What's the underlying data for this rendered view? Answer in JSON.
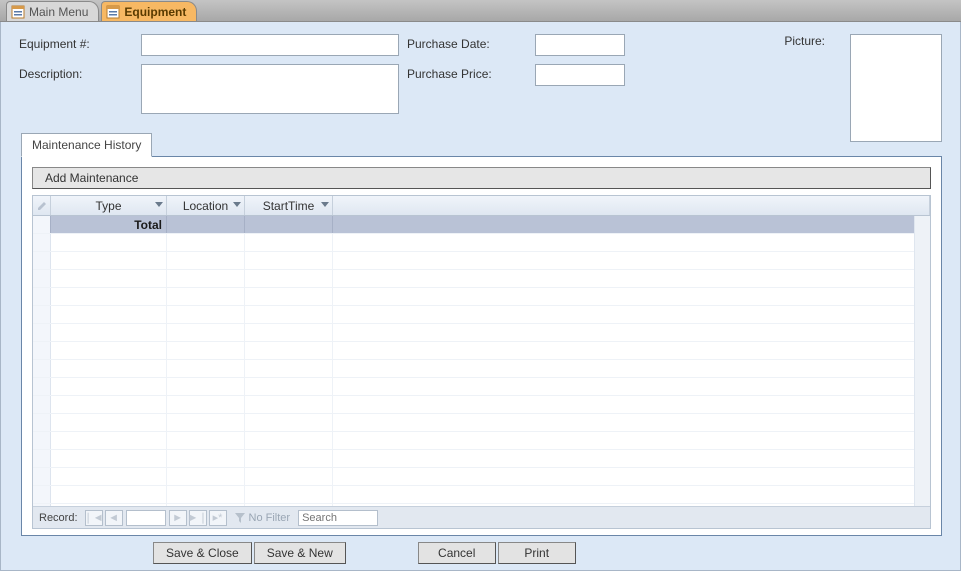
{
  "tabs": {
    "mainmenu": "Main Menu",
    "equipment": "Equipment"
  },
  "labels": {
    "equipmentNo": "Equipment #:",
    "description": "Description:",
    "purchaseDate": "Purchase Date:",
    "purchasePrice": "Purchase Price:",
    "picture": "Picture:"
  },
  "fields": {
    "equipmentNo": "",
    "description": "",
    "purchaseDate": "",
    "purchasePrice": ""
  },
  "maint": {
    "tab": "Maintenance History",
    "addBtn": "Add Maintenance",
    "cols": {
      "type": "Type",
      "location": "Location",
      "startTime": "StartTime"
    },
    "totalLabel": "Total",
    "recordLabel": "Record:",
    "noFilter": "No Filter",
    "searchPlaceholder": "Search"
  },
  "footer": {
    "saveClose": "Save & Close",
    "saveNew": "Save & New",
    "cancel": "Cancel",
    "print": "Print"
  }
}
